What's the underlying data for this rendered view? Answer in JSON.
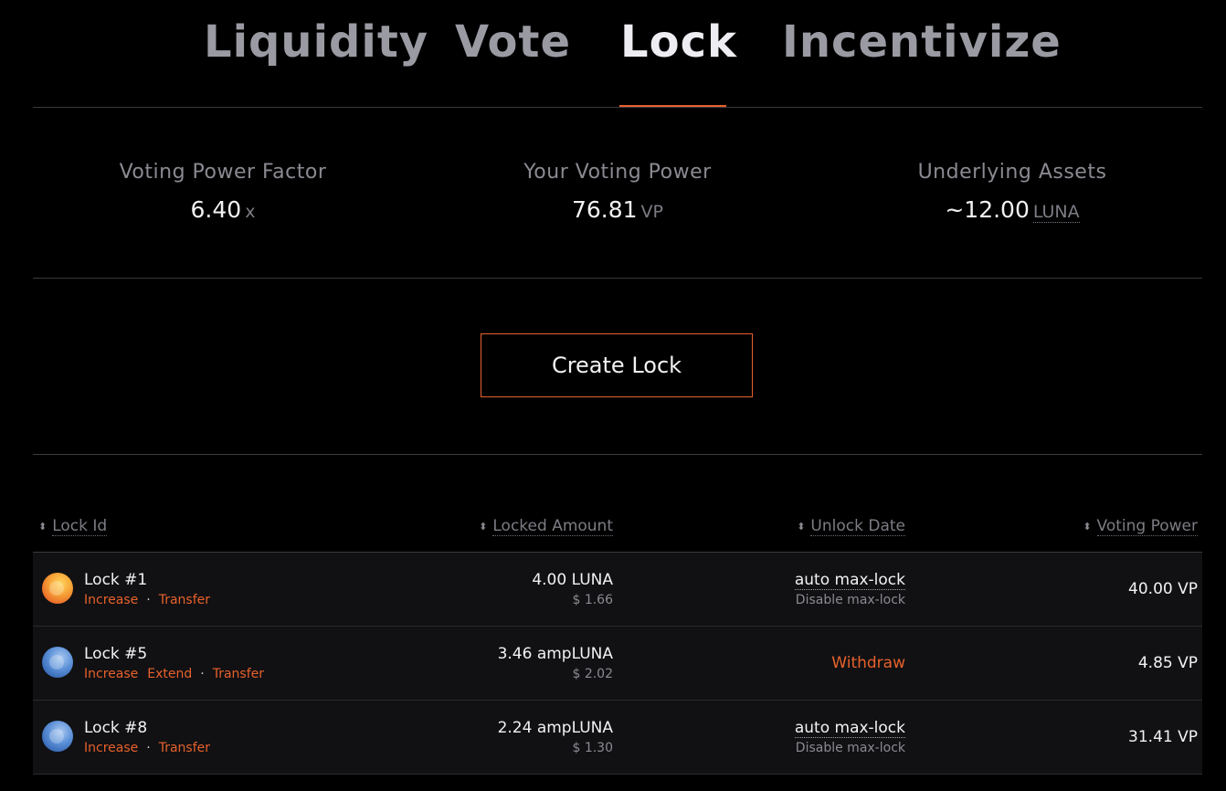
{
  "tabs": [
    {
      "label": "Liquidity",
      "active": false
    },
    {
      "label": "Vote",
      "active": false
    },
    {
      "label": "Lock",
      "active": true
    },
    {
      "label": "Incentivize",
      "active": false
    }
  ],
  "stats": {
    "voting_power_factor": {
      "label": "Voting Power Factor",
      "value": "6.40",
      "unit": "x"
    },
    "your_voting_power": {
      "label": "Your Voting Power",
      "value": "76.81",
      "unit": "VP"
    },
    "underlying_assets": {
      "label": "Underlying Assets",
      "value": "~12.00",
      "unit": "LUNA"
    }
  },
  "create_lock_label": "Create Lock",
  "table": {
    "headers": {
      "lock_id": "Lock Id",
      "locked_amount": "Locked Amount",
      "unlock_date": "Unlock Date",
      "voting_power": "Voting Power"
    },
    "sort_icon": "⬍",
    "rows": [
      {
        "icon": "luna-token-icon",
        "name": "Lock #1",
        "actions": [
          "Increase",
          "Transfer"
        ],
        "amount": "4.00 LUNA",
        "usd": "$ 1.66",
        "unlock": "auto max-lock",
        "unlock_sub": "Disable max-lock",
        "voting_power": "40.00 VP"
      },
      {
        "icon": "ampluna-token-icon",
        "name": "Lock #5",
        "actions": [
          "Increase",
          "Extend",
          "Transfer"
        ],
        "amount": "3.46 ampLUNA",
        "usd": "$ 2.02",
        "unlock": "Withdraw",
        "voting_power": "4.85 VP"
      },
      {
        "icon": "ampluna-token-icon",
        "name": "Lock #8",
        "actions": [
          "Increase",
          "Transfer"
        ],
        "amount": "2.24 ampLUNA",
        "usd": "$ 1.30",
        "unlock": "auto max-lock",
        "unlock_sub": "Disable max-lock",
        "voting_power": "31.41 VP"
      }
    ]
  },
  "colors": {
    "accent": "#e8612c",
    "background": "#000000",
    "row_bg": "#111113"
  }
}
